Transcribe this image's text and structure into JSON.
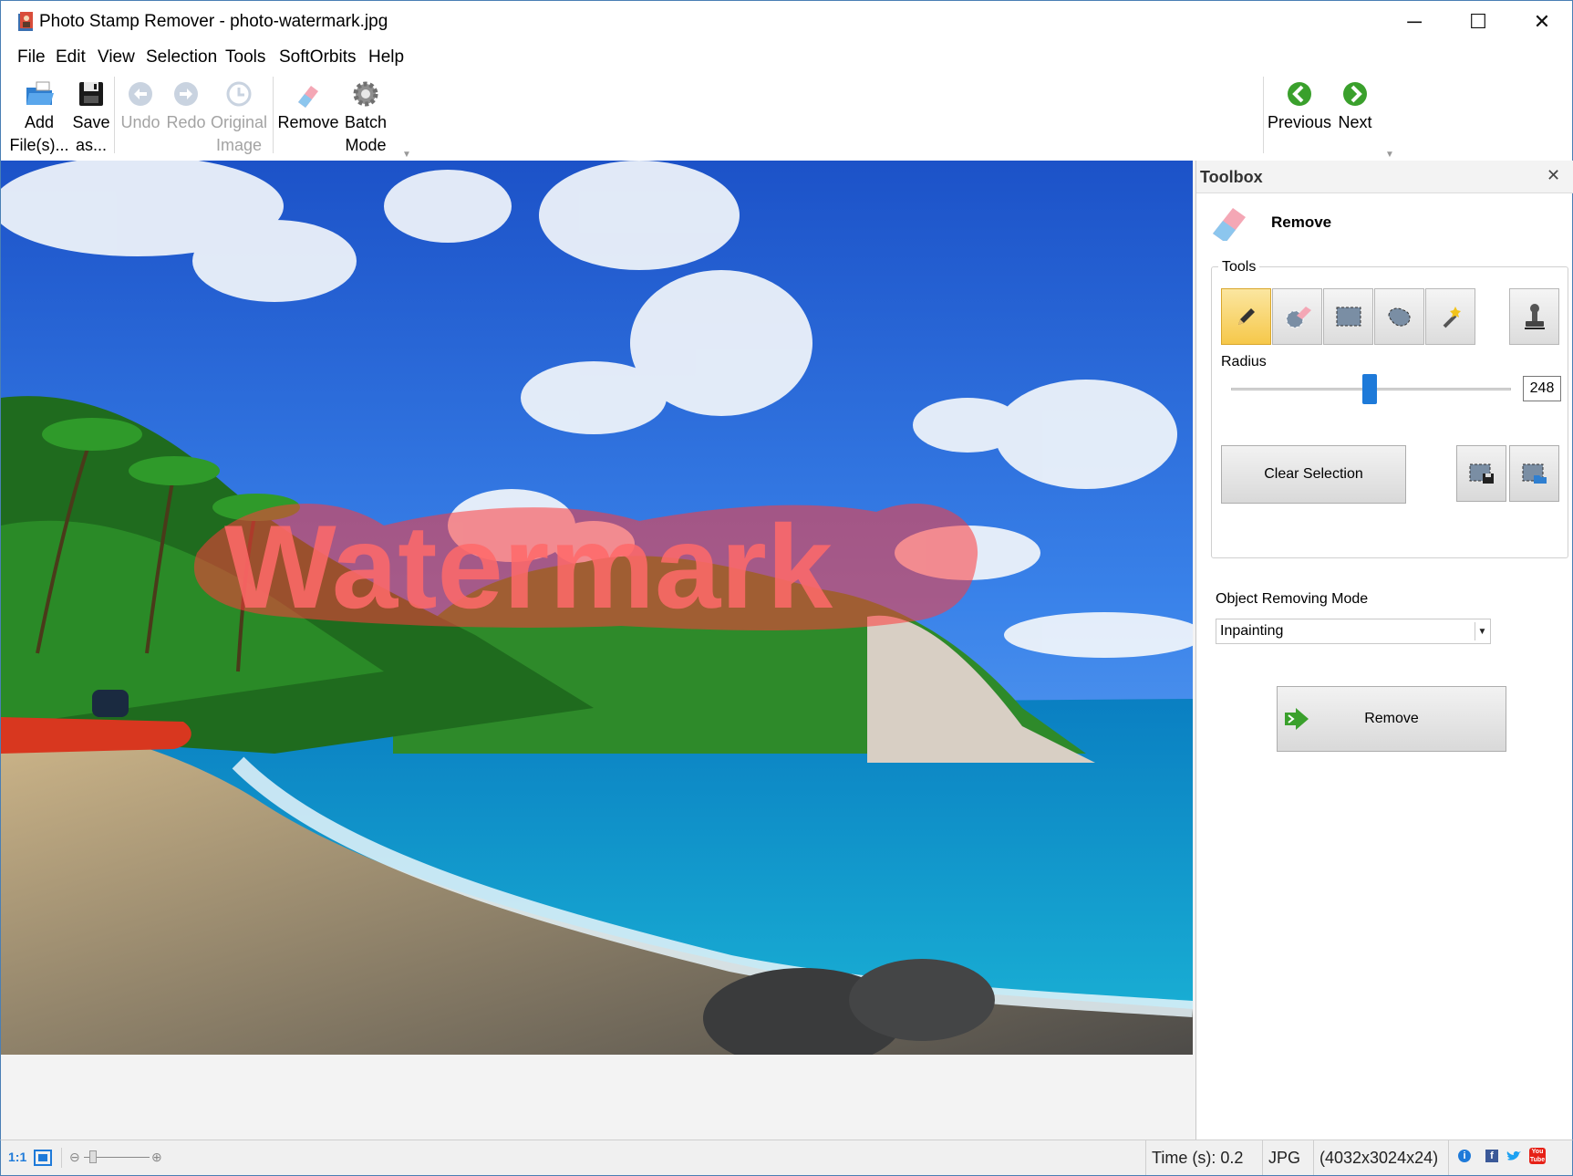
{
  "window": {
    "title": "Photo Stamp Remover - photo-watermark.jpg",
    "minimize_glyph": "─",
    "maximize_glyph": "☐",
    "close_glyph": "✕"
  },
  "menu": [
    "File",
    "Edit",
    "View",
    "Selection",
    "Tools",
    "SoftOrbits",
    "Help"
  ],
  "toolbar": {
    "add_files": [
      "Add",
      "File(s)..."
    ],
    "save_as": [
      "Save",
      "as..."
    ],
    "undo": "Undo",
    "redo": "Redo",
    "original_image": [
      "Original",
      "Image"
    ],
    "remove": "Remove",
    "batch_mode": [
      "Batch",
      "Mode"
    ],
    "previous": "Previous",
    "next": "Next"
  },
  "canvas": {
    "watermark_text": "Watermark"
  },
  "toolbox": {
    "title": "Toolbox",
    "close_glyph": "✕",
    "section_title": "Remove",
    "tools_label": "Tools",
    "tools": [
      "pencil-icon",
      "eraser-icon",
      "rectangle-select-icon",
      "lasso-icon",
      "magic-wand-icon",
      "stamp-icon"
    ],
    "active_tool": "pencil-icon",
    "radius_label": "Radius",
    "radius_value": "248",
    "radius_max": 500,
    "clear_selection": "Clear Selection",
    "mode_label": "Object Removing Mode",
    "mode_value": "Inpainting",
    "remove_button": "Remove"
  },
  "status": {
    "zoom_ratio": "1:1",
    "time": "Time (s): 0.2",
    "format": "JPG",
    "dimensions": "(4032x3024x24)"
  },
  "colors": {
    "accent": "#1e7ad9",
    "selection_mask": "#ff3b3b",
    "nav_green": "#3aa02c"
  }
}
